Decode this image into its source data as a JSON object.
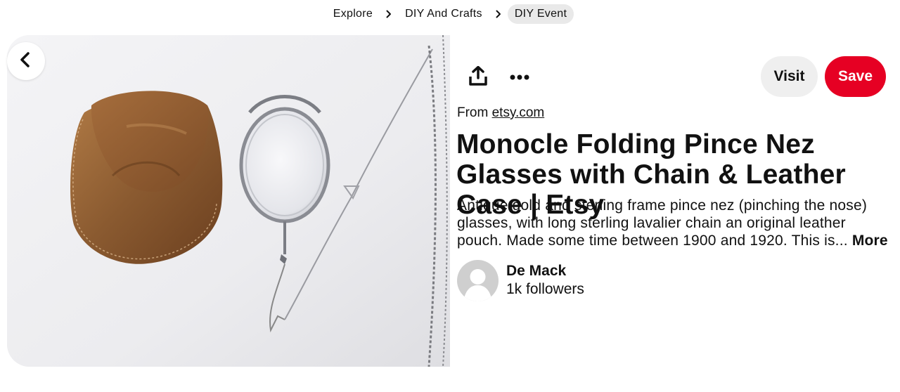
{
  "breadcrumb": {
    "items": [
      {
        "label": "Explore"
      },
      {
        "label": "DIY And Crafts"
      },
      {
        "label": "DIY Event"
      }
    ]
  },
  "actions": {
    "share_icon": "share-upload-icon",
    "more_icon": "more-options-icon",
    "visit_label": "Visit",
    "save_label": "Save"
  },
  "pin": {
    "source_prefix": "From",
    "source_domain": "etsy.com",
    "title": "Monocle Folding Pince Nez Glasses with Chain & Leather Case | Etsy",
    "description": "Antique gold and sterling frame pince nez (pinching the nose) glasses, with long sterling lavalier chain an original leather pouch. Made some time between 1900 and 1920. This is...",
    "more_label": "More"
  },
  "creator": {
    "name": "De Mack",
    "followers": "1k followers"
  },
  "colors": {
    "save": "#e60023",
    "visit": "#efefef",
    "breadcrumb_active": "#e9e9e9"
  }
}
